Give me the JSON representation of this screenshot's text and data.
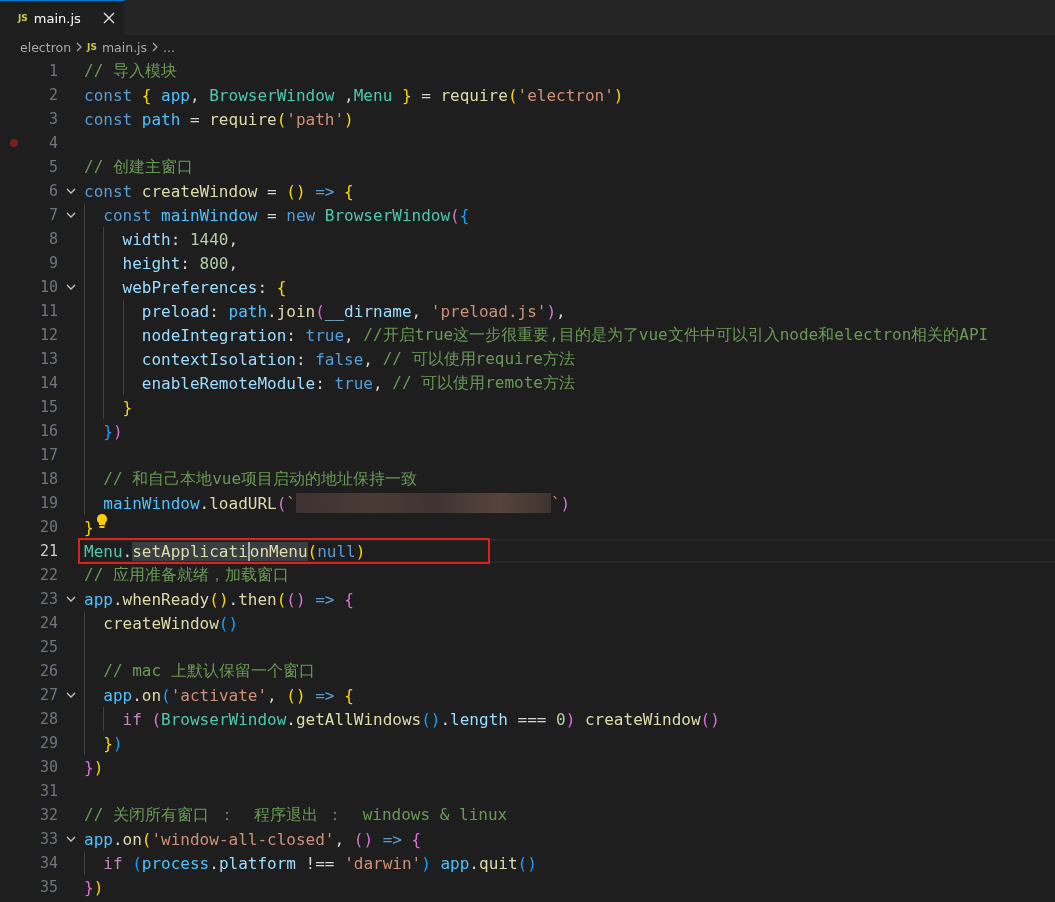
{
  "tabs": [
    {
      "icon": "JS",
      "label": "main.js",
      "selected": true
    }
  ],
  "breadcrumbs": [
    {
      "label": "electron"
    },
    {
      "icon": "JS",
      "label": "main.js"
    },
    {
      "label": "..."
    }
  ],
  "lines": [
    {
      "n": "1",
      "fold": false,
      "breakpoint": false,
      "bulb": false,
      "current": false,
      "boxed": false,
      "tokens": [
        {
          "kind": "comment",
          "text": "// 导入模块"
        }
      ]
    },
    {
      "n": "2",
      "fold": false,
      "breakpoint": false,
      "bulb": false,
      "current": false,
      "boxed": false,
      "tokens": [
        {
          "kind": "keyword",
          "text": "const "
        },
        {
          "kind": "bracket1",
          "text": "{ "
        },
        {
          "kind": "constant",
          "text": "app"
        },
        {
          "kind": "punct",
          "text": ", "
        },
        {
          "kind": "type",
          "text": "BrowserWindow"
        },
        {
          "kind": "punct",
          "text": " ,"
        },
        {
          "kind": "type",
          "text": "Menu "
        },
        {
          "kind": "bracket1",
          "text": "}"
        },
        {
          "kind": "punct",
          "text": " = "
        },
        {
          "kind": "function",
          "text": "require"
        },
        {
          "kind": "bracket1",
          "text": "("
        },
        {
          "kind": "string",
          "text": "'electron'"
        },
        {
          "kind": "bracket1",
          "text": ")"
        }
      ]
    },
    {
      "n": "3",
      "fold": false,
      "breakpoint": false,
      "bulb": false,
      "current": false,
      "boxed": false,
      "tokens": [
        {
          "kind": "keyword",
          "text": "const "
        },
        {
          "kind": "constant",
          "text": "path"
        },
        {
          "kind": "punct",
          "text": " = "
        },
        {
          "kind": "function",
          "text": "require"
        },
        {
          "kind": "bracket1",
          "text": "("
        },
        {
          "kind": "string",
          "text": "'path'"
        },
        {
          "kind": "bracket1",
          "text": ")"
        }
      ]
    },
    {
      "n": "4",
      "fold": false,
      "breakpoint": true,
      "bulb": false,
      "current": false,
      "boxed": false
    },
    {
      "n": "5",
      "fold": false,
      "breakpoint": false,
      "bulb": false,
      "current": false,
      "boxed": false,
      "tokens": [
        {
          "kind": "comment",
          "text": "// 创建主窗口"
        }
      ]
    },
    {
      "n": "6",
      "fold": true,
      "breakpoint": false,
      "bulb": false,
      "current": false,
      "boxed": false,
      "tokens": [
        {
          "kind": "keyword",
          "text": "const "
        },
        {
          "kind": "function",
          "text": "createWindow"
        },
        {
          "kind": "punct",
          "text": " = "
        },
        {
          "kind": "bracket1",
          "text": "() "
        },
        {
          "kind": "keyword",
          "text": "=> "
        },
        {
          "kind": "bracket1",
          "text": "{"
        }
      ]
    },
    {
      "n": "7",
      "fold": true,
      "breakpoint": false,
      "bulb": false,
      "current": false,
      "boxed": false,
      "tokens": [
        {
          "kind": "keyword",
          "text": "  const "
        },
        {
          "kind": "constant",
          "text": "mainWindow"
        },
        {
          "kind": "punct",
          "text": " = "
        },
        {
          "kind": "keyword",
          "text": "new "
        },
        {
          "kind": "type",
          "text": "BrowserWindow"
        },
        {
          "kind": "bracket2",
          "text": "("
        },
        {
          "kind": "bracket3",
          "text": "{"
        }
      ]
    },
    {
      "n": "8",
      "fold": false,
      "breakpoint": false,
      "bulb": false,
      "current": false,
      "boxed": false,
      "tokens": [
        {
          "kind": "variable",
          "text": "    width"
        },
        {
          "kind": "punct",
          "text": ": "
        },
        {
          "kind": "number",
          "text": "1440"
        },
        {
          "kind": "punct",
          "text": ","
        }
      ]
    },
    {
      "n": "9",
      "fold": false,
      "breakpoint": false,
      "bulb": false,
      "current": false,
      "boxed": false,
      "tokens": [
        {
          "kind": "variable",
          "text": "    height"
        },
        {
          "kind": "punct",
          "text": ": "
        },
        {
          "kind": "number",
          "text": "800"
        },
        {
          "kind": "punct",
          "text": ","
        }
      ]
    },
    {
      "n": "10",
      "fold": true,
      "breakpoint": false,
      "bulb": false,
      "current": false,
      "boxed": false,
      "tokens": [
        {
          "kind": "variable",
          "text": "    webPreferences"
        },
        {
          "kind": "punct",
          "text": ": "
        },
        {
          "kind": "bracket1",
          "text": "{"
        }
      ]
    },
    {
      "n": "11",
      "fold": false,
      "breakpoint": false,
      "bulb": false,
      "current": false,
      "boxed": false,
      "tokens": [
        {
          "kind": "variable",
          "text": "      preload"
        },
        {
          "kind": "punct",
          "text": ": "
        },
        {
          "kind": "constant",
          "text": "path"
        },
        {
          "kind": "punct",
          "text": "."
        },
        {
          "kind": "function",
          "text": "join"
        },
        {
          "kind": "bracket2",
          "text": "("
        },
        {
          "kind": "variable",
          "text": "__dirname"
        },
        {
          "kind": "punct",
          "text": ", "
        },
        {
          "kind": "string",
          "text": "'preload.js'"
        },
        {
          "kind": "bracket2",
          "text": ")"
        },
        {
          "kind": "punct",
          "text": ","
        }
      ]
    },
    {
      "n": "12",
      "fold": false,
      "breakpoint": false,
      "bulb": false,
      "current": false,
      "boxed": false,
      "tokens": [
        {
          "kind": "variable",
          "text": "      nodeIntegration"
        },
        {
          "kind": "punct",
          "text": ": "
        },
        {
          "kind": "keyword",
          "text": "true"
        },
        {
          "kind": "punct",
          "text": ", "
        },
        {
          "kind": "comment",
          "text": "//开启true这一步很重要,目的是为了vue文件中可以引入node和electron相关的API"
        }
      ]
    },
    {
      "n": "13",
      "fold": false,
      "breakpoint": false,
      "bulb": false,
      "current": false,
      "boxed": false,
      "tokens": [
        {
          "kind": "variable",
          "text": "      contextIsolation"
        },
        {
          "kind": "punct",
          "text": ": "
        },
        {
          "kind": "keyword",
          "text": "false"
        },
        {
          "kind": "punct",
          "text": ", "
        },
        {
          "kind": "comment",
          "text": "// 可以使用require方法"
        }
      ]
    },
    {
      "n": "14",
      "fold": false,
      "breakpoint": false,
      "bulb": false,
      "current": false,
      "boxed": false,
      "tokens": [
        {
          "kind": "variable",
          "text": "      enableRemoteModule"
        },
        {
          "kind": "punct",
          "text": ": "
        },
        {
          "kind": "keyword",
          "text": "true"
        },
        {
          "kind": "punct",
          "text": ", "
        },
        {
          "kind": "comment",
          "text": "// 可以使用remote方法"
        }
      ]
    },
    {
      "n": "15",
      "fold": false,
      "breakpoint": false,
      "bulb": false,
      "current": false,
      "boxed": false,
      "tokens": [
        {
          "kind": "bracket1",
          "text": "    }"
        }
      ]
    },
    {
      "n": "16",
      "fold": false,
      "breakpoint": false,
      "bulb": false,
      "current": false,
      "boxed": false,
      "tokens": [
        {
          "kind": "bracket3",
          "text": "  }"
        },
        {
          "kind": "bracket2",
          "text": ")"
        }
      ]
    },
    {
      "n": "17",
      "fold": false,
      "breakpoint": false,
      "bulb": false,
      "current": false,
      "boxed": false
    },
    {
      "n": "18",
      "fold": false,
      "breakpoint": false,
      "bulb": false,
      "current": false,
      "boxed": false,
      "tokens": [
        {
          "kind": "comment",
          "text": "  // 和自己本地vue项目启动的地址保持一致"
        }
      ]
    },
    {
      "n": "19",
      "fold": false,
      "breakpoint": false,
      "bulb": false,
      "current": false,
      "boxed": false,
      "tokens": [
        {
          "kind": "constant",
          "text": "  mainWindow"
        },
        {
          "kind": "punct",
          "text": "."
        },
        {
          "kind": "function",
          "text": "loadURL"
        },
        {
          "kind": "bracket2",
          "text": "("
        },
        {
          "kind": "string",
          "text": "`"
        },
        {
          "kind": "blur"
        },
        {
          "kind": "string",
          "text": "`"
        },
        {
          "kind": "bracket2",
          "text": ")"
        }
      ]
    },
    {
      "n": "20",
      "fold": false,
      "breakpoint": false,
      "bulb": true,
      "current": false,
      "boxed": false,
      "tokens": [
        {
          "kind": "bracket1",
          "text": "}"
        }
      ]
    },
    {
      "n": "21",
      "fold": false,
      "breakpoint": false,
      "bulb": false,
      "current": true,
      "boxed": true,
      "tokens": [
        {
          "kind": "type",
          "text": "Menu"
        },
        {
          "kind": "punct",
          "text": "."
        },
        {
          "kind": "highlight",
          "text": "setApplicati"
        },
        {
          "kind": "caret"
        },
        {
          "kind": "highlight",
          "text": "onMenu"
        },
        {
          "kind": "bracket1",
          "text": "("
        },
        {
          "kind": "keyword",
          "text": "null"
        },
        {
          "kind": "bracket1",
          "text": ")"
        }
      ]
    },
    {
      "n": "22",
      "fold": false,
      "breakpoint": false,
      "bulb": false,
      "current": false,
      "boxed": false,
      "tokens": [
        {
          "kind": "comment",
          "text": "// 应用准备就绪，加载窗口"
        }
      ]
    },
    {
      "n": "23",
      "fold": true,
      "breakpoint": false,
      "bulb": false,
      "current": false,
      "boxed": false,
      "tokens": [
        {
          "kind": "constant",
          "text": "app"
        },
        {
          "kind": "punct",
          "text": "."
        },
        {
          "kind": "function",
          "text": "whenReady"
        },
        {
          "kind": "bracket1",
          "text": "()"
        },
        {
          "kind": "punct",
          "text": "."
        },
        {
          "kind": "function",
          "text": "then"
        },
        {
          "kind": "bracket1",
          "text": "("
        },
        {
          "kind": "bracket2",
          "text": "() "
        },
        {
          "kind": "keyword",
          "text": "=> "
        },
        {
          "kind": "bracket2",
          "text": "{"
        }
      ]
    },
    {
      "n": "24",
      "fold": false,
      "breakpoint": false,
      "bulb": false,
      "current": false,
      "boxed": false,
      "tokens": [
        {
          "kind": "function",
          "text": "  createWindow"
        },
        {
          "kind": "bracket3",
          "text": "()"
        }
      ]
    },
    {
      "n": "25",
      "fold": false,
      "breakpoint": false,
      "bulb": false,
      "current": false,
      "boxed": false
    },
    {
      "n": "26",
      "fold": false,
      "breakpoint": false,
      "bulb": false,
      "current": false,
      "boxed": false,
      "tokens": [
        {
          "kind": "comment",
          "text": "  // mac 上默认保留一个窗口"
        }
      ]
    },
    {
      "n": "27",
      "fold": true,
      "breakpoint": false,
      "bulb": false,
      "current": false,
      "boxed": false,
      "tokens": [
        {
          "kind": "constant",
          "text": "  app"
        },
        {
          "kind": "punct",
          "text": "."
        },
        {
          "kind": "function",
          "text": "on"
        },
        {
          "kind": "bracket3",
          "text": "("
        },
        {
          "kind": "string",
          "text": "'activate'"
        },
        {
          "kind": "punct",
          "text": ", "
        },
        {
          "kind": "bracket1",
          "text": "() "
        },
        {
          "kind": "keyword",
          "text": "=> "
        },
        {
          "kind": "bracket1",
          "text": "{"
        }
      ]
    },
    {
      "n": "28",
      "fold": false,
      "breakpoint": false,
      "bulb": false,
      "current": false,
      "boxed": false,
      "tokens": [
        {
          "kind": "control",
          "text": "    if "
        },
        {
          "kind": "bracket2",
          "text": "("
        },
        {
          "kind": "type",
          "text": "BrowserWindow"
        },
        {
          "kind": "punct",
          "text": "."
        },
        {
          "kind": "function",
          "text": "getAllWindows"
        },
        {
          "kind": "bracket3",
          "text": "()"
        },
        {
          "kind": "punct",
          "text": "."
        },
        {
          "kind": "variable",
          "text": "length"
        },
        {
          "kind": "punct",
          "text": " === "
        },
        {
          "kind": "number",
          "text": "0"
        },
        {
          "kind": "bracket2",
          "text": ") "
        },
        {
          "kind": "function",
          "text": "createWindow"
        },
        {
          "kind": "bracket2",
          "text": "()"
        }
      ]
    },
    {
      "n": "29",
      "fold": false,
      "breakpoint": false,
      "bulb": false,
      "current": false,
      "boxed": false,
      "tokens": [
        {
          "kind": "bracket1",
          "text": "  }"
        },
        {
          "kind": "bracket3",
          "text": ")"
        }
      ]
    },
    {
      "n": "30",
      "fold": false,
      "breakpoint": false,
      "bulb": false,
      "current": false,
      "boxed": false,
      "tokens": [
        {
          "kind": "bracket2",
          "text": "}"
        },
        {
          "kind": "bracket1",
          "text": ")"
        }
      ]
    },
    {
      "n": "31",
      "fold": false,
      "breakpoint": false,
      "bulb": false,
      "current": false,
      "boxed": false
    },
    {
      "n": "32",
      "fold": false,
      "breakpoint": false,
      "bulb": false,
      "current": false,
      "boxed": false,
      "tokens": [
        {
          "kind": "comment",
          "text": "// 关闭所有窗口 ：  程序退出 ：  windows & linux"
        }
      ]
    },
    {
      "n": "33",
      "fold": true,
      "breakpoint": false,
      "bulb": false,
      "current": false,
      "boxed": false,
      "tokens": [
        {
          "kind": "constant",
          "text": "app"
        },
        {
          "kind": "punct",
          "text": "."
        },
        {
          "kind": "function",
          "text": "on"
        },
        {
          "kind": "bracket1",
          "text": "("
        },
        {
          "kind": "string",
          "text": "'window-all-closed'"
        },
        {
          "kind": "punct",
          "text": ", "
        },
        {
          "kind": "bracket2",
          "text": "() "
        },
        {
          "kind": "keyword",
          "text": "=> "
        },
        {
          "kind": "bracket2",
          "text": "{"
        }
      ]
    },
    {
      "n": "34",
      "fold": false,
      "breakpoint": false,
      "bulb": false,
      "current": false,
      "boxed": false,
      "tokens": [
        {
          "kind": "control",
          "text": "  if "
        },
        {
          "kind": "bracket3",
          "text": "("
        },
        {
          "kind": "constant",
          "text": "process"
        },
        {
          "kind": "punct",
          "text": "."
        },
        {
          "kind": "variable",
          "text": "platform"
        },
        {
          "kind": "punct",
          "text": " !== "
        },
        {
          "kind": "string",
          "text": "'darwin'"
        },
        {
          "kind": "bracket3",
          "text": ") "
        },
        {
          "kind": "constant",
          "text": "app"
        },
        {
          "kind": "punct",
          "text": "."
        },
        {
          "kind": "function",
          "text": "quit"
        },
        {
          "kind": "bracket3",
          "text": "()"
        }
      ]
    },
    {
      "n": "35",
      "fold": false,
      "breakpoint": false,
      "bulb": false,
      "current": false,
      "boxed": false,
      "tokens": [
        {
          "kind": "bracket2",
          "text": "}"
        },
        {
          "kind": "bracket1",
          "text": ")"
        }
      ]
    }
  ]
}
